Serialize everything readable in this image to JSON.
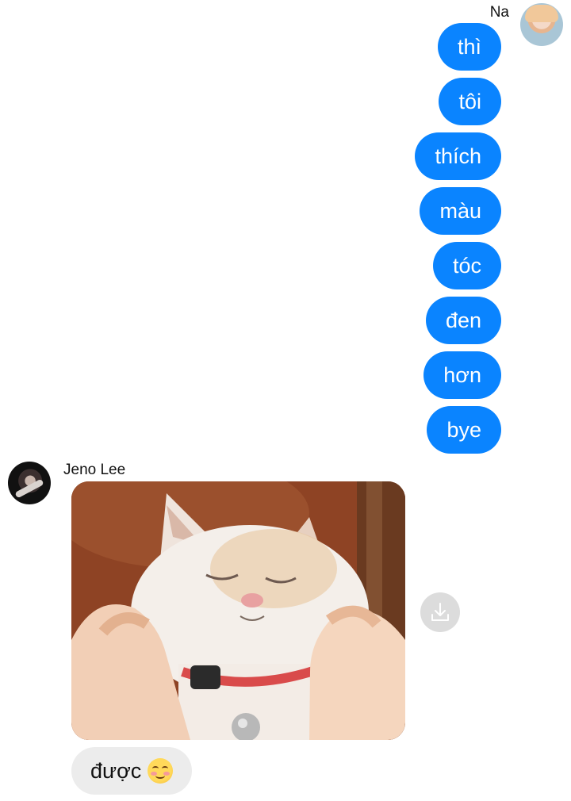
{
  "outgoing": {
    "sender": "Na",
    "messages": [
      "thì",
      "tôi",
      "thích",
      "màu",
      "tóc",
      "đen",
      "hơn",
      "bye"
    ]
  },
  "incoming": {
    "sender": "Jeno Lee",
    "image_alt": "cat photo",
    "text": "được",
    "emoji": "smiling-face-with-smiling-eyes"
  },
  "colors": {
    "outgoing_bubble": "#0a84ff",
    "incoming_bubble": "#ececec"
  }
}
